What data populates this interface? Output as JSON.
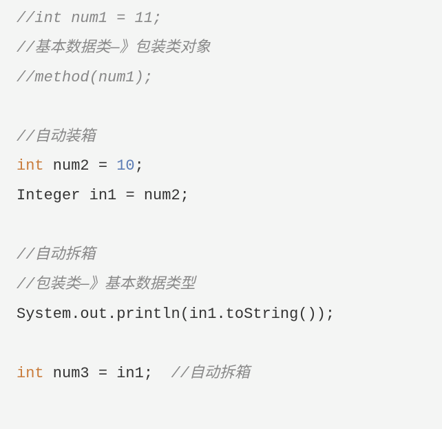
{
  "lines": [
    {
      "type": "comment",
      "text": "//int num1 = 11;"
    },
    {
      "type": "comment",
      "text": "//基本数据类—》包装类对象"
    },
    {
      "type": "comment",
      "text": "//method(num1);"
    },
    {
      "type": "blank",
      "text": ""
    },
    {
      "type": "comment",
      "text": "//自动装箱"
    },
    {
      "type": "code",
      "tokens": [
        {
          "cls": "keyword",
          "text": "int"
        },
        {
          "cls": "identifier",
          "text": " num2 "
        },
        {
          "cls": "punct",
          "text": "= "
        },
        {
          "cls": "number",
          "text": "10"
        },
        {
          "cls": "punct",
          "text": ";"
        }
      ]
    },
    {
      "type": "code",
      "tokens": [
        {
          "cls": "identifier",
          "text": "Integer in1 "
        },
        {
          "cls": "punct",
          "text": "= "
        },
        {
          "cls": "identifier",
          "text": "num2"
        },
        {
          "cls": "punct",
          "text": ";"
        }
      ]
    },
    {
      "type": "blank",
      "text": ""
    },
    {
      "type": "comment",
      "text": "//自动拆箱"
    },
    {
      "type": "comment",
      "text": "//包装类—》基本数据类型"
    },
    {
      "type": "code",
      "tokens": [
        {
          "cls": "identifier",
          "text": "System"
        },
        {
          "cls": "punct",
          "text": "."
        },
        {
          "cls": "identifier",
          "text": "out"
        },
        {
          "cls": "punct",
          "text": "."
        },
        {
          "cls": "method",
          "text": "println"
        },
        {
          "cls": "punct",
          "text": "("
        },
        {
          "cls": "identifier",
          "text": "in1"
        },
        {
          "cls": "punct",
          "text": "."
        },
        {
          "cls": "method",
          "text": "toString"
        },
        {
          "cls": "punct",
          "text": "());"
        }
      ]
    },
    {
      "type": "blank",
      "text": ""
    },
    {
      "type": "code-with-comment",
      "tokens": [
        {
          "cls": "keyword",
          "text": "int"
        },
        {
          "cls": "identifier",
          "text": " num3 "
        },
        {
          "cls": "punct",
          "text": "= "
        },
        {
          "cls": "identifier",
          "text": "in1"
        },
        {
          "cls": "punct",
          "text": ";  "
        },
        {
          "cls": "comment",
          "text": "//自动拆箱"
        }
      ]
    }
  ]
}
